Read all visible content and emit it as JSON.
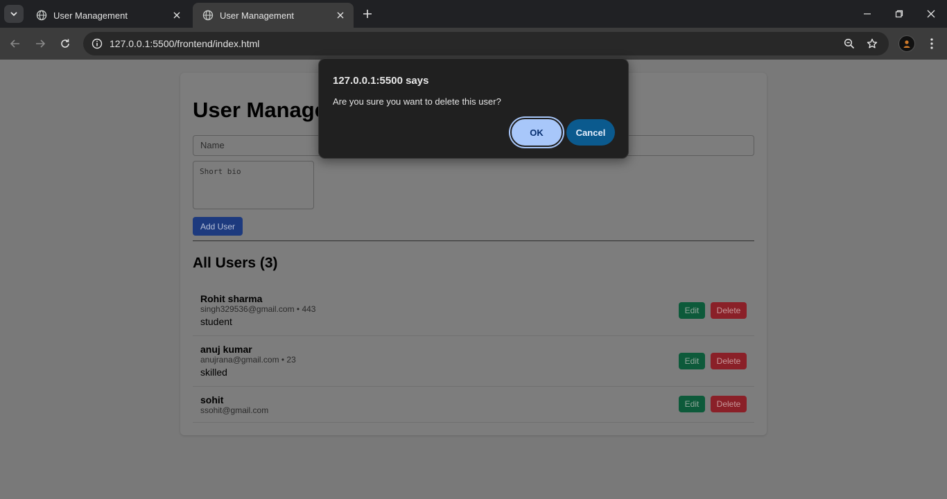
{
  "browser": {
    "tabs": [
      {
        "title": "User Management",
        "active": false
      },
      {
        "title": "User Management",
        "active": true
      }
    ],
    "url": "127.0.0.1:5500/frontend/index.html"
  },
  "page": {
    "title": "User Management",
    "form": {
      "name_placeholder": "Name",
      "bio_placeholder": "Short bio",
      "add_label": "Add User"
    },
    "list_title": "All Users (3)",
    "users": [
      {
        "name": "Rohit sharma",
        "meta": "singh329536@gmail.com • 443",
        "bio": "student"
      },
      {
        "name": "anuj kumar",
        "meta": "anujrana@gmail.com • 23",
        "bio": "skilled"
      },
      {
        "name": "sohit",
        "meta": "ssohit@gmail.com",
        "bio": ""
      }
    ],
    "edit_label": "Edit",
    "delete_label": "Delete"
  },
  "dialog": {
    "title": "127.0.0.1:5500 says",
    "message": "Are you sure you want to delete this user?",
    "ok_label": "OK",
    "cancel_label": "Cancel"
  },
  "colors": {
    "add_button": "#2a55c0",
    "edit_button": "#158556",
    "delete_button": "#d6333f",
    "dialog_ok": "#a8c7fa",
    "dialog_cancel": "#0b5a8e"
  }
}
